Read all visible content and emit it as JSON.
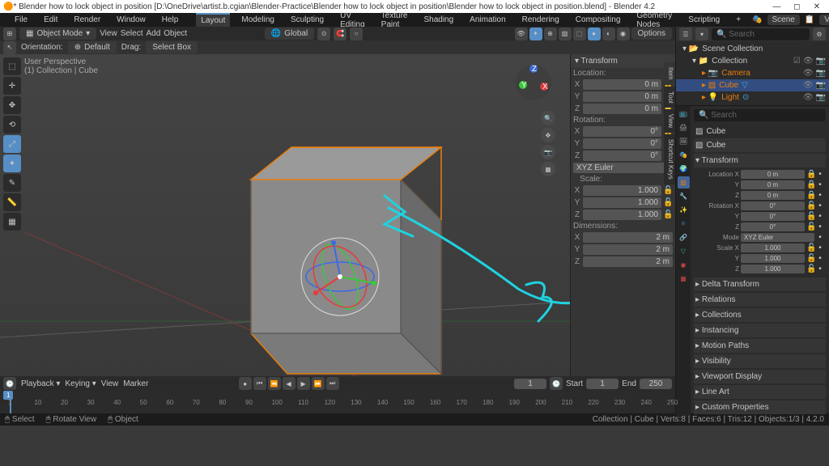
{
  "window": {
    "title": "* Blender how to lock object in position [D:\\OneDrive\\artist.b.cgian\\Blender-Practice\\Blender how to lock object in position\\Blender how to lock object in position.blend] - Blender 4.2"
  },
  "menus": [
    "File",
    "Edit",
    "Render",
    "Window",
    "Help"
  ],
  "workspaces": [
    "Layout",
    "Modeling",
    "Sculpting",
    "UV Editing",
    "Texture Paint",
    "Shading",
    "Animation",
    "Rendering",
    "Compositing",
    "Geometry Nodes",
    "Scripting"
  ],
  "active_workspace": "Layout",
  "scene": {
    "scene_label": "Scene",
    "viewlayer_label": "ViewLayer"
  },
  "header2": {
    "mode": "Object Mode",
    "menus": [
      "View",
      "Select",
      "Add",
      "Object"
    ],
    "orientation_label": "Global",
    "options_label": "Options"
  },
  "header3": {
    "orientation_label": "Orientation:",
    "orientation_value": "Default",
    "drag_label": "Drag:",
    "drag_value": "Select Box"
  },
  "viewport": {
    "user_persp": "User Perspective",
    "breadcrumb": "(1) Collection | Cube"
  },
  "n_panel": {
    "title": "Transform",
    "location_label": "Location:",
    "rotation_label": "Rotation:",
    "rotation_mode": "XYZ Euler",
    "scale_label": "Scale:",
    "dimensions_label": "Dimensions:",
    "location": {
      "x": "0 m",
      "y": "0 m",
      "z": "0 m"
    },
    "location_locked": {
      "x": true,
      "y": true,
      "z": true
    },
    "rotation": {
      "x": "0°",
      "y": "0°",
      "z": "0°"
    },
    "rotation_locked": {
      "x": false,
      "y": false,
      "z": false
    },
    "scale": {
      "x": "1.000",
      "y": "1.000",
      "z": "1.000"
    },
    "dimensions": {
      "x": "2 m",
      "y": "2 m",
      "z": "2 m"
    },
    "tabs": [
      "Item",
      "Tool",
      "View",
      "Shortcut Keys"
    ]
  },
  "outliner": {
    "search_placeholder": "Search",
    "root": "Scene Collection",
    "collection": "Collection",
    "items": [
      {
        "name": "Camera",
        "icon": "camera",
        "selected": false
      },
      {
        "name": "Cube",
        "icon": "mesh",
        "selected": true
      },
      {
        "name": "Light",
        "icon": "light",
        "selected": false
      }
    ]
  },
  "properties": {
    "search_placeholder": "Search",
    "object_name": "Cube",
    "datablock_name": "Cube",
    "transform_header": "Transform",
    "location_label": "Location X",
    "rotation_label": "Rotation X",
    "mode_label": "Mode",
    "mode_value": "XYZ Euler",
    "scale_label": "Scale X",
    "location": {
      "x": "0 m",
      "y": "0 m",
      "z": "0 m"
    },
    "rotation": {
      "x": "0°",
      "y": "0°",
      "z": "0°"
    },
    "scale": {
      "x": "1.000",
      "y": "1.000",
      "z": "1.000"
    },
    "location_locked": {
      "x": true,
      "y": true,
      "z": true
    },
    "sections": [
      "Delta Transform",
      "Relations",
      "Collections",
      "Instancing",
      "Motion Paths",
      "Visibility",
      "Viewport Display",
      "Line Art",
      "Custom Properties"
    ]
  },
  "timeline": {
    "playback_label": "Playback",
    "keying_label": "Keying",
    "view_label": "View",
    "marker_label": "Marker",
    "current": 1,
    "start_label": "Start",
    "start": 1,
    "end_label": "End",
    "end": 250,
    "ticks": [
      1,
      10,
      20,
      30,
      40,
      50,
      60,
      70,
      80,
      90,
      100,
      110,
      120,
      130,
      140,
      150,
      160,
      170,
      180,
      190,
      200,
      210,
      220,
      230,
      240,
      250
    ]
  },
  "statusbar": {
    "left": [
      {
        "icon": "🖱",
        "label": "Select"
      },
      {
        "icon": "🖱",
        "label": "Rotate View"
      },
      {
        "icon": "🖱",
        "label": "Object"
      }
    ],
    "right": "Collection | Cube | Verts:8 | Faces:6 | Tris:12 | Objects:1/3 | 4.2.0"
  },
  "colors": {
    "accent": "#568fc5",
    "orange": "#e87d0d",
    "annotation": "#1fd2e0"
  }
}
